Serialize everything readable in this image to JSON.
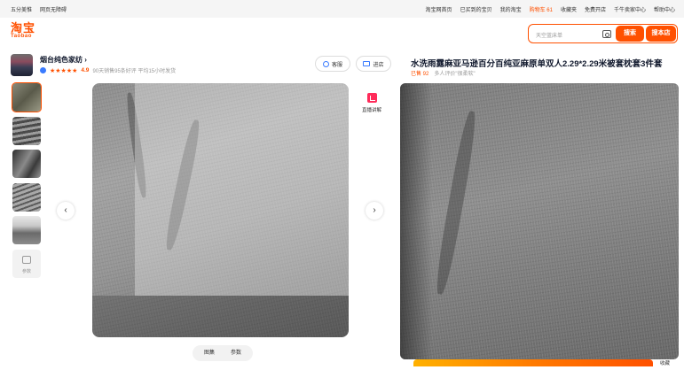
{
  "topbar": {
    "left": [
      "五分美惟",
      "网页无障碍"
    ],
    "right": [
      "淘宝网首页",
      "已买到的宝贝",
      "我的淘宝",
      "购物车 61",
      "收藏夹",
      "免费开店",
      "千牛卖家中心",
      "帮助中心"
    ]
  },
  "header": {
    "logo_cn": "淘宝",
    "logo_en": "Taobao",
    "search_placeholder": "天空蓝床单",
    "search_button": "搜索",
    "shop_button": "搜本店"
  },
  "shop": {
    "name": "烟台纯色家纺 ›",
    "rating": "4.9",
    "stars": "★★★★★",
    "meta": "90天销售95条好评  平均15小时发货",
    "service_button": "客服",
    "enter_button": "进店"
  },
  "gallery": {
    "more_label": "参数",
    "tabs": [
      "图集",
      "参数"
    ],
    "video_label": "直播讲解",
    "prev": "‹",
    "next": "›"
  },
  "product": {
    "title": "水洗雨露麻亚马逊百分百纯亚麻原单双人2.29*2.29米被套枕套3件套",
    "sold": "已售 92",
    "sold_sub": "多人评价\"很柔软\"",
    "collect": "收藏"
  },
  "colors": {
    "accent": "#ff5000"
  }
}
